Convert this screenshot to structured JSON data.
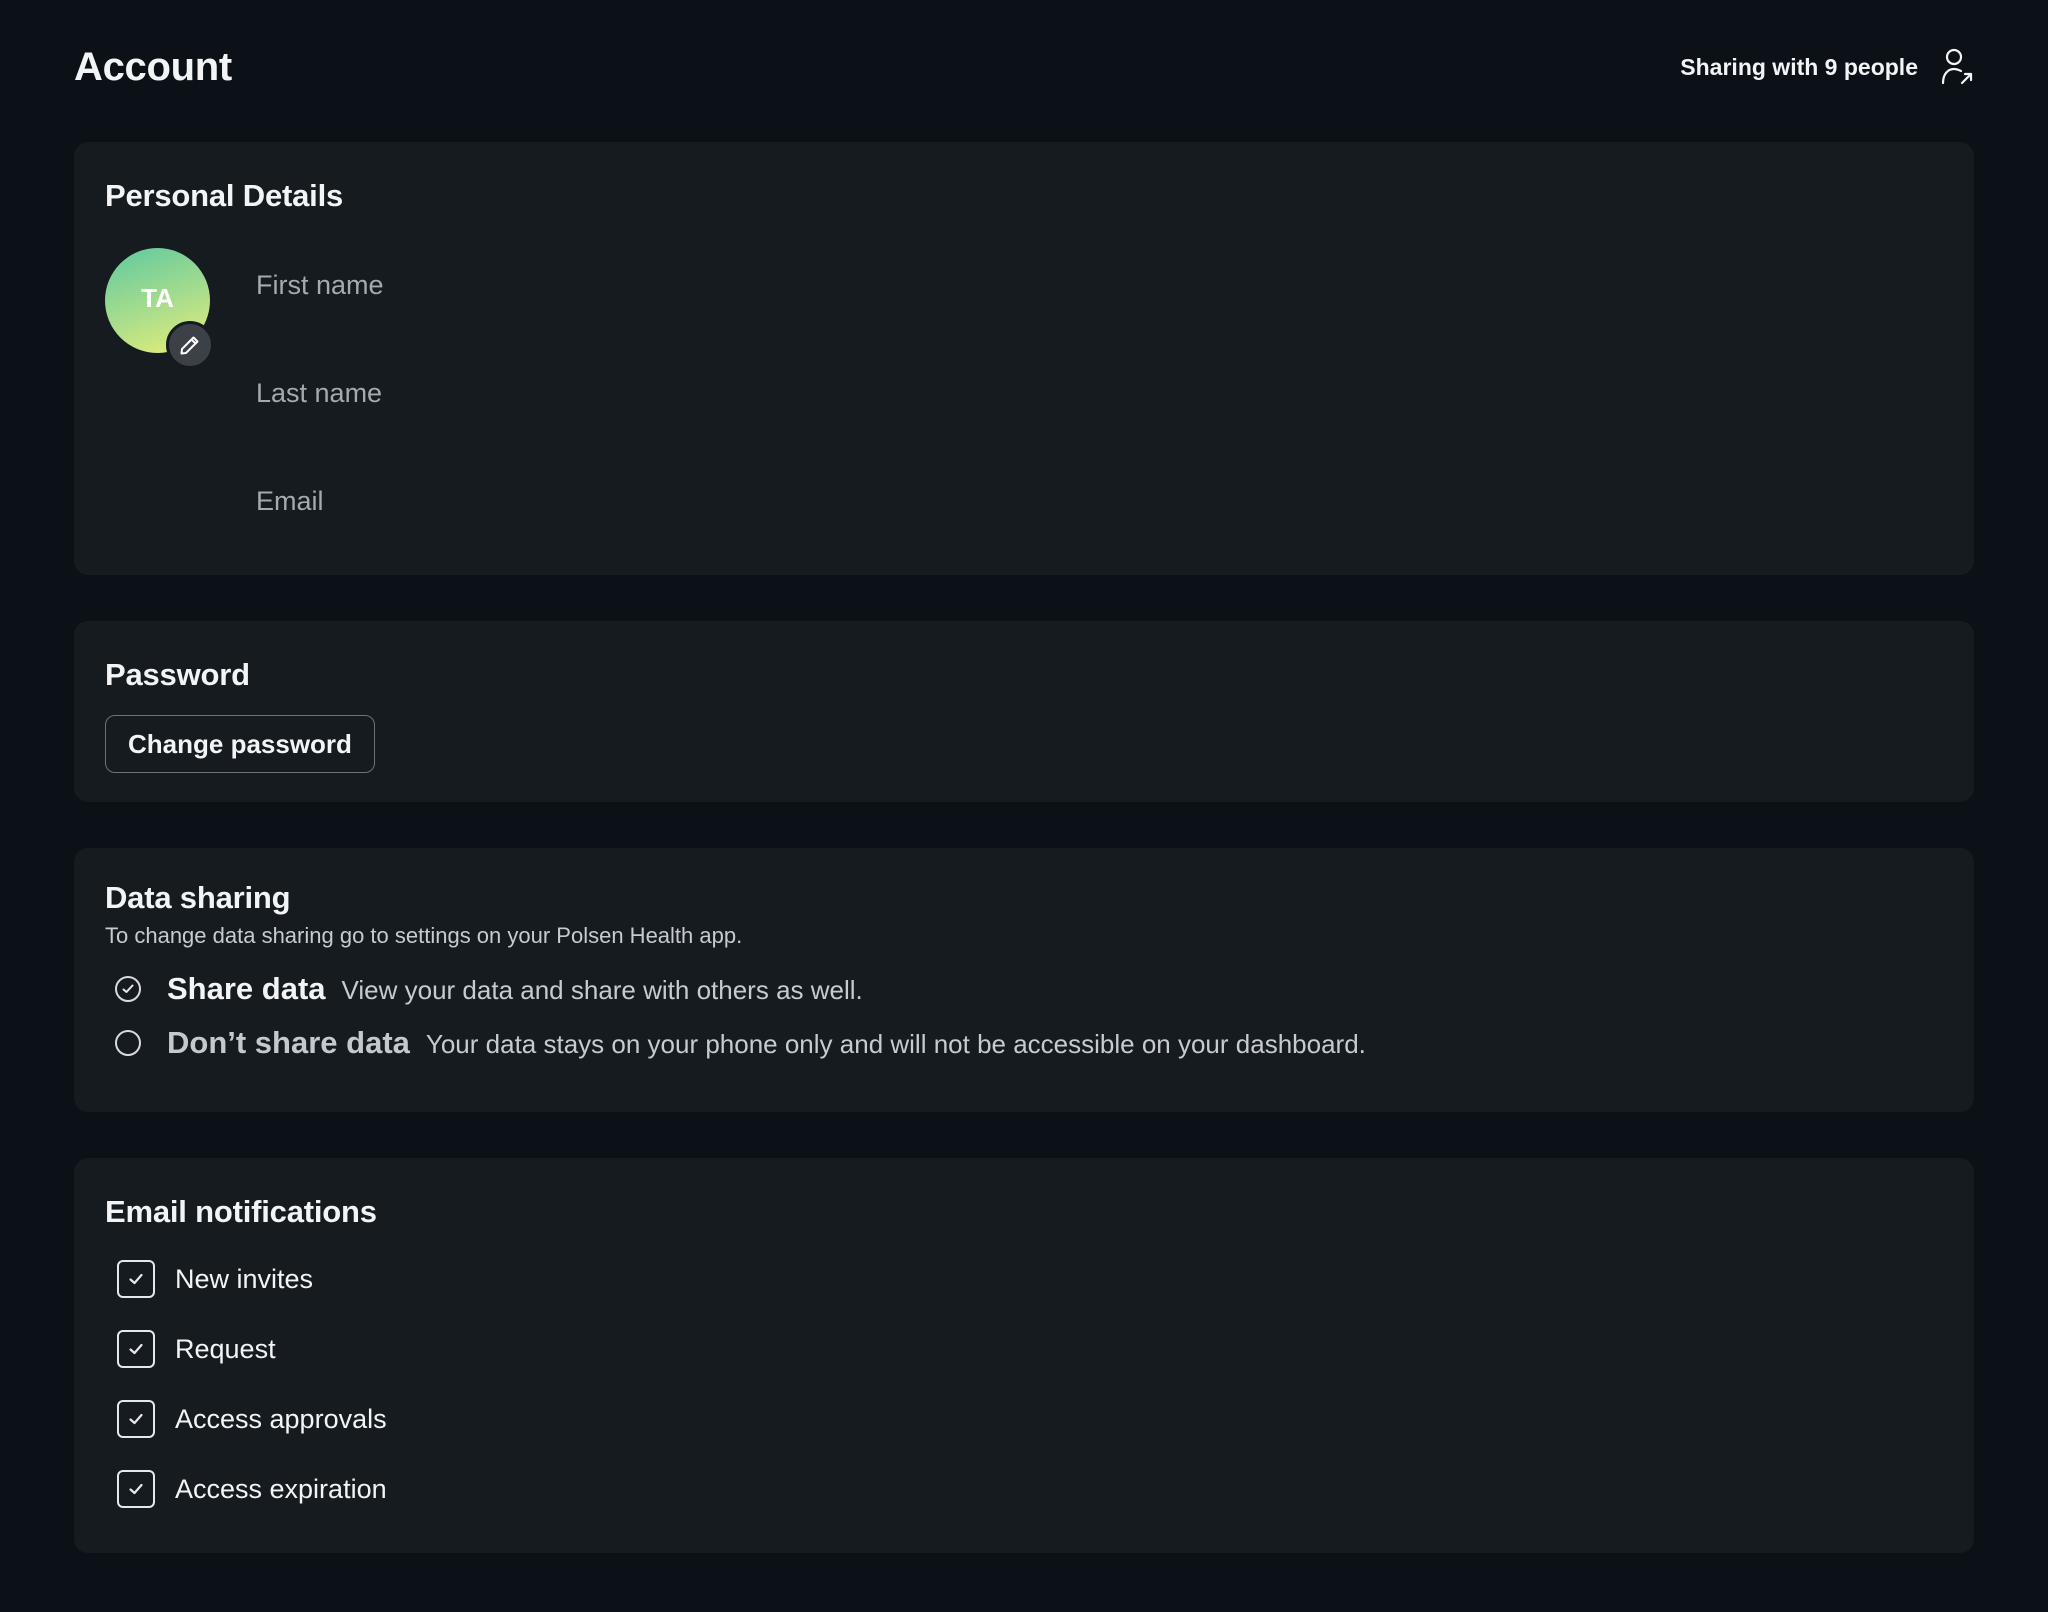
{
  "header": {
    "title": "Account",
    "sharing_label": "Sharing with 9 people",
    "sharing_icon": "user-share-icon"
  },
  "personal_details": {
    "title": "Personal Details",
    "avatar_initials": "TA",
    "avatar_edit_icon": "pencil-icon",
    "first_name": {
      "value": "",
      "placeholder": "First name"
    },
    "last_name": {
      "value": "",
      "placeholder": "Last name"
    },
    "email": {
      "value": "",
      "placeholder": "Email"
    }
  },
  "password": {
    "title": "Password",
    "change_button": "Change password"
  },
  "data_sharing": {
    "title": "Data sharing",
    "subtitle": "To change data sharing go to settings on your Polsen Health app.",
    "options": [
      {
        "title": "Share data",
        "description": "View your data and share with others as well.",
        "selected": true
      },
      {
        "title": "Don’t share data",
        "description": "Your data stays on your phone only and will not be accessible on your dashboard.",
        "selected": false
      }
    ]
  },
  "email_notifications": {
    "title": "Email notifications",
    "items": [
      {
        "label": "New invites",
        "checked": true
      },
      {
        "label": "Request",
        "checked": true
      },
      {
        "label": "Access approvals",
        "checked": true
      },
      {
        "label": "Access expiration",
        "checked": true
      }
    ]
  },
  "colors": {
    "background": "#0b1116",
    "card": "#161b20",
    "text": "#f2f4f5",
    "muted_text": "#c6cbd0",
    "avatar_gradient_start": "#5ec9a0",
    "avatar_gradient_end": "#e8ef78"
  }
}
